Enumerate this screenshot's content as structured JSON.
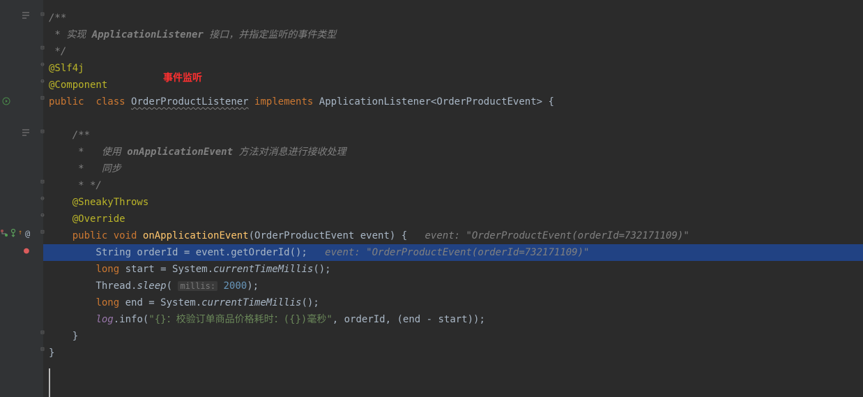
{
  "annot_label": "事件监听",
  "lines": {
    "l1": "/**",
    "l2_a": " * 实现 ",
    "l2_b": "ApplicationListener",
    "l2_c": " 接口，并指定监听的事件类型",
    "l3": " */",
    "l4": "@Slf4j",
    "l5": "@Component",
    "l6_public": "public",
    "l6_class": "class",
    "l6_name": "OrderProductListener",
    "l6_impl": "implements",
    "l6_type": "ApplicationListener<OrderProductEvent> {",
    "l7": "",
    "l8": "    /**",
    "l9_a": "     *   使用 ",
    "l9_b": "onApplicationEvent",
    "l9_c": " 方法对消息进行接收处理",
    "l10": "     *   同步",
    "l11": "     * */",
    "l12": "    @SneakyThrows",
    "l13": "    @Override",
    "l14_pre": "    ",
    "l14_public": "public",
    "l14_void": "void",
    "l14_method": "onApplicationEvent",
    "l14_params": "(OrderProductEvent event) {",
    "l14_hint": "event: \"OrderProductEvent(orderId=732171109)\"",
    "l15_pre": "        String orderId = event.getOrderId();",
    "l15_hint": "event: \"OrderProductEvent(orderId=732171109)\"",
    "l16_a": "        ",
    "l16_long": "long",
    "l16_b": " start = System.",
    "l16_method": "currentTimeMillis",
    "l16_c": "();",
    "l17_a": "        Thread.",
    "l17_sleep": "sleep",
    "l17_paren": "(",
    "l17_hint": "millis:",
    "l17_num": "2000",
    "l17_end": ");",
    "l18_a": "        ",
    "l18_long": "long",
    "l18_b": " end = System.",
    "l18_method": "currentTimeMillis",
    "l18_c": "();",
    "l19_a": "        ",
    "l19_log": "log",
    "l19_b": ".info(",
    "l19_str": "\"{}：校验订单商品价格耗时：({})毫秒\"",
    "l19_c": ", orderId, (end - start));",
    "l20": "    }",
    "l21": "}"
  },
  "gutter": {
    "override_tooltip": "@",
    "breakpoint": "●"
  }
}
